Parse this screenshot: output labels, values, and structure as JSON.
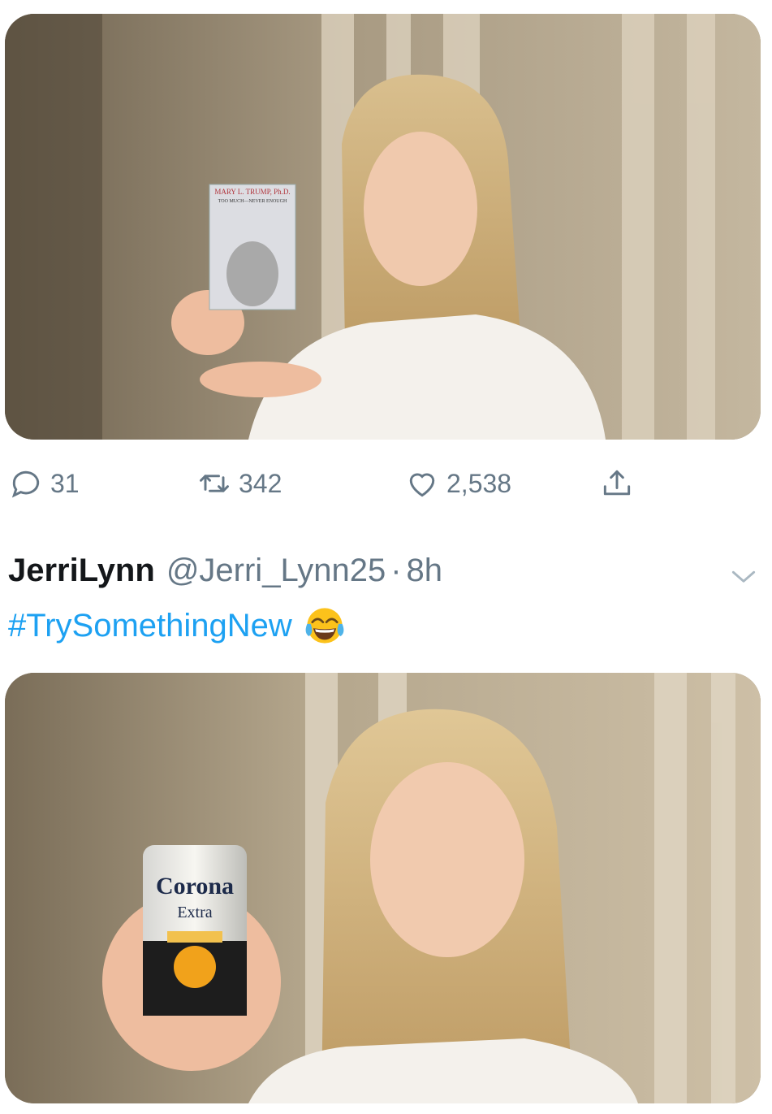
{
  "tweet1": {
    "media_alt": "Photo: woman in a white blouse holding up a book",
    "book": {
      "author": "MARY L. TRUMP, Ph.D.",
      "title": "TOO MUCH—NEVER ENOUGH"
    },
    "actions": {
      "replies": "31",
      "retweets": "342",
      "likes": "2,538"
    }
  },
  "tweet2": {
    "display_name": "JerriLynn",
    "handle": "@Jerri_Lynn25",
    "separator": "·",
    "time": "8h",
    "hashtag": "#TrySomethingNew",
    "emoji": "face-with-tears-of-joy",
    "media_alt": "Photo: woman in a white blouse holding up a beer can",
    "can": {
      "brand": "Corona",
      "sub": "Extra"
    }
  },
  "colors": {
    "link": "#1da1f2",
    "secondary_text": "#657786",
    "primary_text": "#14171a"
  },
  "icons": [
    "reply-icon",
    "retweet-icon",
    "like-icon",
    "share-icon",
    "chevron-down-icon"
  ]
}
